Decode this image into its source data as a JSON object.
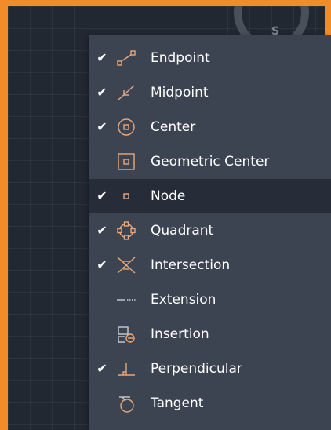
{
  "viewcube": {
    "compass_label": "S"
  },
  "menu": {
    "items": [
      {
        "label": "Endpoint",
        "checked": true,
        "icon": "endpoint-icon"
      },
      {
        "label": "Midpoint",
        "checked": true,
        "icon": "midpoint-icon"
      },
      {
        "label": "Center",
        "checked": true,
        "icon": "center-icon"
      },
      {
        "label": "Geometric Center",
        "checked": false,
        "icon": "geometric-center-icon"
      },
      {
        "label": "Node",
        "checked": true,
        "icon": "node-icon",
        "highlighted": true
      },
      {
        "label": "Quadrant",
        "checked": true,
        "icon": "quadrant-icon"
      },
      {
        "label": "Intersection",
        "checked": true,
        "icon": "intersection-icon"
      },
      {
        "label": "Extension",
        "checked": false,
        "icon": "extension-icon"
      },
      {
        "label": "Insertion",
        "checked": false,
        "icon": "insertion-icon"
      },
      {
        "label": "Perpendicular",
        "checked": true,
        "icon": "perpendicular-icon"
      },
      {
        "label": "Tangent",
        "checked": false,
        "icon": "tangent-icon"
      }
    ],
    "check_glyph": "✔",
    "icon_color": "#e8a87c",
    "highlight_color": "#262d38"
  }
}
